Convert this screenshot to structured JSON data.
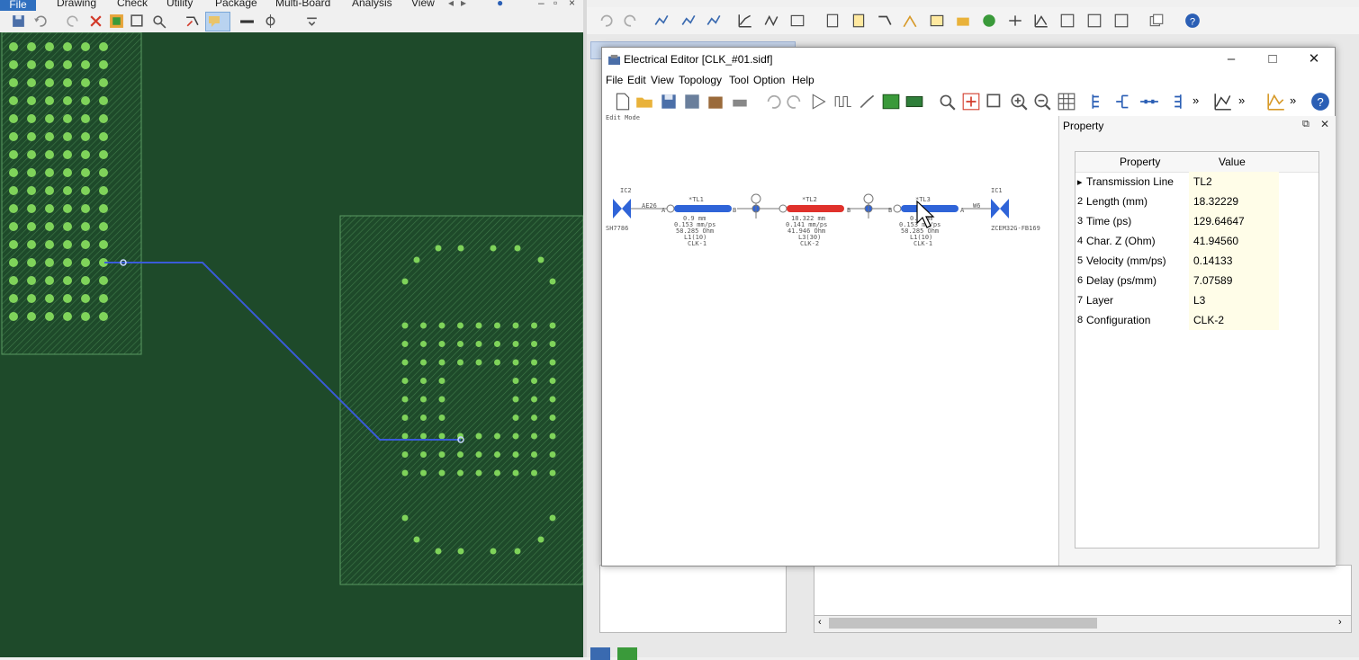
{
  "left_app": {
    "menu": [
      "File",
      "Drawing",
      "Check",
      "Utility",
      "Package",
      "Multi-Board",
      "Analysis",
      "View"
    ]
  },
  "editor": {
    "title": "Electrical Editor [CLK_#01.sidf]",
    "menu": [
      "File",
      "Edit",
      "View",
      "Topology",
      "Tool",
      "Option",
      "Help"
    ],
    "mode_label": "Edit Mode",
    "schematic": {
      "left_ic": {
        "name": "IC2",
        "part": "SH7786",
        "pin": "AE26"
      },
      "right_ic": {
        "name": "IC1",
        "part": "ZCEM32G-FB169",
        "pin": "W6"
      },
      "lines": [
        {
          "name": "*TL1",
          "color": "#2f64d8",
          "info": [
            "0.9 mm",
            "0.153 mm/ps",
            "58.285 Ohm",
            "L1(10)",
            "CLK-1"
          ]
        },
        {
          "name": "*TL2",
          "color": "#e0312b",
          "info": [
            "18.322 mm",
            "0.141 mm/ps",
            "41.946 Ohm",
            "L3(30)",
            "CLK-2"
          ]
        },
        {
          "name": "*TL3",
          "color": "#2f64d8",
          "info": [
            "0.9 mm",
            "0.153 mm/ps",
            "58.285 Ohm",
            "L1(10)",
            "CLK-1"
          ]
        }
      ]
    }
  },
  "property_panel": {
    "title": "Property",
    "header": {
      "property": "Property",
      "value": "Value"
    },
    "rows": [
      {
        "num": "▸",
        "name": "Transmission Line",
        "value": "TL2"
      },
      {
        "num": "2",
        "name": "Length (mm)",
        "value": "18.32229"
      },
      {
        "num": "3",
        "name": "Time (ps)",
        "value": "129.64647"
      },
      {
        "num": "4",
        "name": "Char. Z (Ohm)",
        "value": "41.94560"
      },
      {
        "num": "5",
        "name": "Velocity (mm/ps)",
        "value": "0.14133"
      },
      {
        "num": "6",
        "name": "Delay (ps/mm)",
        "value": "7.07589"
      },
      {
        "num": "7",
        "name": "Layer",
        "value": "L3"
      },
      {
        "num": "8",
        "name": "Configuration",
        "value": "CLK-2"
      }
    ]
  },
  "colors": {
    "pcb_bg": "#1e4a2a",
    "pad": "#7fd35a",
    "trace": "#3a5bd9",
    "accent": "#2f6fbf"
  }
}
